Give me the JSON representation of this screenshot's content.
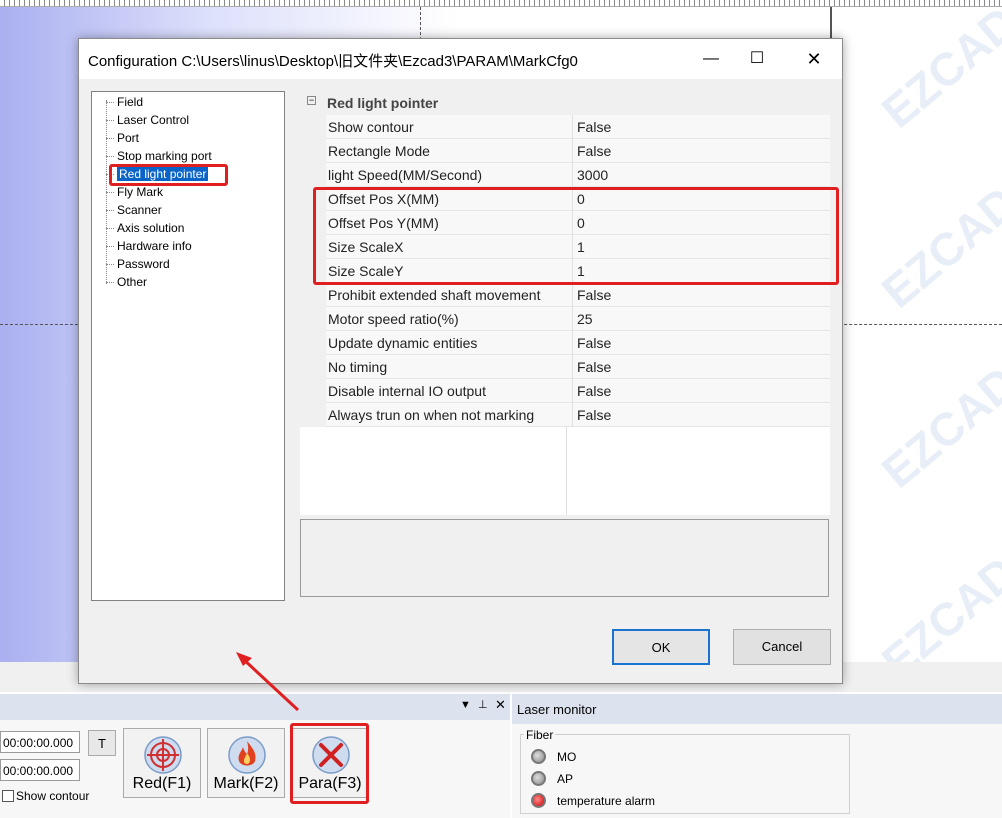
{
  "dialog": {
    "title": "Configuration C:\\Users\\linus\\Desktop\\旧文件夹\\Ezcad3\\PARAM\\MarkCfg0",
    "minimize_icon": "minimize-icon",
    "maximize_icon": "maximize-icon",
    "close_icon": "close-icon",
    "tree": [
      "Field",
      "Laser Control",
      "Port",
      "Stop marking port",
      "Red light pointer",
      "Fly Mark",
      "Scanner",
      "Axis solution",
      "Hardware info",
      "Password",
      "Other"
    ],
    "selected_tree_item": "Red light pointer",
    "grid_category": "Red light pointer",
    "properties": [
      {
        "name": "Show contour",
        "value": "False"
      },
      {
        "name": "Rectangle Mode",
        "value": "False"
      },
      {
        "name": "light Speed(MM/Second)",
        "value": "3000"
      },
      {
        "name": "Offset Pos X(MM)",
        "value": "0"
      },
      {
        "name": "Offset Pos Y(MM)",
        "value": "0"
      },
      {
        "name": "Size ScaleX",
        "value": "1"
      },
      {
        "name": "Size ScaleY",
        "value": "1"
      },
      {
        "name": "Prohibit extended shaft movement",
        "value": "False"
      },
      {
        "name": "Motor speed ratio(%)",
        "value": "25"
      },
      {
        "name": "Update dynamic entities",
        "value": "False"
      },
      {
        "name": "No timing",
        "value": "False"
      },
      {
        "name": "Disable internal IO output",
        "value": "False"
      },
      {
        "name": "Always trun on when not marking",
        "value": "False"
      }
    ],
    "ok_label": "OK",
    "cancel_label": "Cancel"
  },
  "bottom_panel": {
    "time1": "00:00:00.000",
    "time2": "00:00:00.000",
    "t_button": "T",
    "show_contour_label": "Show contour",
    "buttons": [
      {
        "label": "Red(F1)",
        "icon": "crosshair-icon"
      },
      {
        "label": "Mark(F2)",
        "icon": "flame-icon"
      },
      {
        "label": "Para(F3)",
        "icon": "tools-icon"
      }
    ]
  },
  "laser_monitor": {
    "title": "Laser monitor",
    "group": "Fiber",
    "indicators": [
      {
        "label": "MO",
        "state": "off"
      },
      {
        "label": "AP",
        "state": "off"
      },
      {
        "label": "temperature alarm",
        "state": "on"
      }
    ]
  },
  "watermark": "EZCAD",
  "colors": {
    "highlight": "#e02020",
    "selection": "#0a64c8",
    "alarm": "#d00000"
  }
}
